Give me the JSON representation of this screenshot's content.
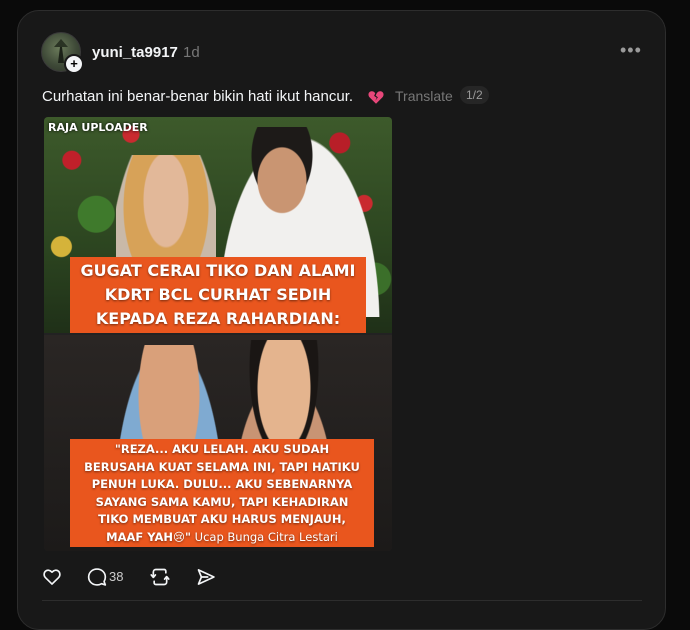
{
  "post": {
    "username": "yuni_ta9917",
    "time": "1d",
    "more_label": "•••",
    "follow_plus": "+",
    "caption": "Curhatan ini benar-benar bikin hati ikut hancur.",
    "emoji_icon": "broken-heart-icon",
    "translate_label": "Translate",
    "image_counter": "1/2"
  },
  "image": {
    "watermark": "RAJA UPLOADER",
    "headline_lines": [
      "GUGAT CERAI TIKO DAN ALAMI",
      "KDRT BCL CURHAT SEDIH",
      "KEPADA REZA RAHARDIAN:"
    ],
    "quote_lines": [
      "\"REZA... AKU LELAH. AKU SUDAH",
      "BERUSAHA KUAT SELAMA INI, TAPI HATIKU",
      "PENUH LUKA. DULU... AKU SEBENARNYA",
      "SAYANG SAMA KAMU, TAPI KEHADIRAN",
      "TIKO MEMBUAT AKU HARUS MENJAUH,"
    ],
    "quote_last": "MAAF YAH😢\"",
    "attribution": " Ucap Bunga Citra Lestari"
  },
  "actions": {
    "like_icon": "heart-outline-icon",
    "reply_icon": "comment-icon",
    "reply_count": "38",
    "repost_icon": "repost-icon",
    "share_icon": "send-icon"
  },
  "colors": {
    "background": "#0a0a0a",
    "card": "#181818",
    "banner_orange": "#e9561e",
    "muted_text": "#777777",
    "broken_heart": "#e8477a"
  }
}
